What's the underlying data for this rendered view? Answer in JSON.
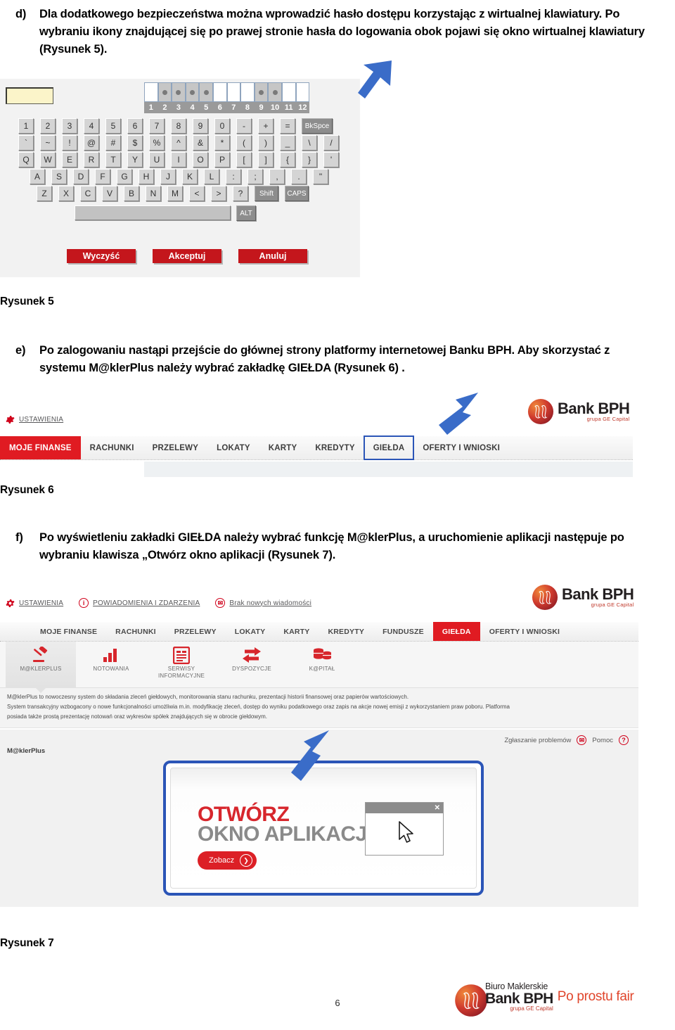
{
  "document": {
    "page_number": "6",
    "paragraphs": [
      {
        "marker": "d)",
        "text": "Dla dodatkowego bezpieczeństwa można wprowadzić hasło dostępu korzystając z wirtualnej klawiatury. Po wybraniu ikony znajdującej się po prawej stronie hasła do logowania obok pojawi się okno wirtualnej klawiatury (Rysunek 5)."
      },
      {
        "marker": "e)",
        "text": "Po zalogowaniu nastąpi przejście do głównej strony platformy internetowej Banku BPH. Aby skorzystać z systemu M@klerPlus należy wybrać zakładkę GIEŁDA (Rysunek 6) ."
      },
      {
        "marker": "f)",
        "text": "Po wyświetleniu zakładki GIEŁDA należy wybrać funkcję M@klerPlus, a uruchomienie aplikacji następuje po wybraniu klawisza „Otwórz okno aplikacji (Rysunek 7)."
      }
    ],
    "captions": {
      "fig5": "Rysunek 5",
      "fig6": "Rysunek 6",
      "fig7": "Rysunek 7"
    }
  },
  "figure5": {
    "password_field_value": "",
    "strength_meter": {
      "numbers": [
        "1",
        "2",
        "3",
        "4",
        "5",
        "6",
        "7",
        "8",
        "9",
        "10",
        "11",
        "12"
      ],
      "filled": [
        false,
        true,
        true,
        true,
        true,
        false,
        false,
        false,
        true,
        true,
        false,
        false
      ]
    },
    "keyboard_rows": [
      [
        "1",
        "2",
        "3",
        "4",
        "5",
        "6",
        "7",
        "8",
        "9",
        "0",
        "-",
        "+",
        "=",
        "BkSpce"
      ],
      [
        "`",
        "~",
        "!",
        "@",
        "#",
        "$",
        "%",
        "^",
        "&",
        "*",
        "(",
        ")",
        "_",
        "\\",
        "/"
      ],
      [
        "Q",
        "W",
        "E",
        "R",
        "T",
        "Y",
        "U",
        "I",
        "O",
        "P",
        "[",
        "]",
        "{",
        "}",
        "'"
      ],
      [
        "A",
        "S",
        "D",
        "F",
        "G",
        "H",
        "J",
        "K",
        "L",
        ":",
        ";",
        ",",
        ".",
        "\""
      ],
      [
        "Z",
        "X",
        "C",
        "V",
        "B",
        "N",
        "M",
        "<",
        ">",
        "?",
        "Shift",
        "CAPS"
      ]
    ],
    "alt_key": "ALT",
    "action_buttons": [
      "Wyczyść",
      "Akceptuj",
      "Anuluj"
    ],
    "colors": {
      "action_red": "#c4161c",
      "field_yellow": "#fbf4c9"
    }
  },
  "figure6": {
    "utility_links": [
      {
        "icon": "gear-icon",
        "label": "USTAWIENIA"
      }
    ],
    "logo": {
      "line1_light": "Bank ",
      "line1_bold": "BPH",
      "line2": "grupa GE Capital"
    },
    "nav_tabs": [
      {
        "label": "MOJE FINANSE",
        "state": "active-red"
      },
      {
        "label": "RACHUNKI",
        "state": "normal"
      },
      {
        "label": "PRZELEWY",
        "state": "normal"
      },
      {
        "label": "LOKATY",
        "state": "normal"
      },
      {
        "label": "KARTY",
        "state": "normal"
      },
      {
        "label": "KREDYTY",
        "state": "normal"
      },
      {
        "label": "GIEŁDA",
        "state": "highlighted"
      },
      {
        "label": "OFERTY I WNIOSKI",
        "state": "normal"
      }
    ],
    "colors": {
      "tab_red": "#e01b22",
      "highlight_blue": "#2b55b7"
    }
  },
  "figure7": {
    "utility_links": [
      {
        "icon": "gear-icon",
        "glyph": "",
        "label": "USTAWIENIA"
      },
      {
        "icon": "info-icon",
        "glyph": "i",
        "label": "POWIADOMIENIA I ZDARZENIA"
      },
      {
        "icon": "envelope-icon",
        "glyph": "✉",
        "label": "Brak nowych wiadomości"
      }
    ],
    "logo": {
      "line1_light": "Bank ",
      "line1_bold": "BPH",
      "line2": "grupa GE Capital"
    },
    "nav_tabs": [
      {
        "label": "MOJE FINANSE",
        "state": "normal"
      },
      {
        "label": "RACHUNKI",
        "state": "normal"
      },
      {
        "label": "PRZELEWY",
        "state": "normal"
      },
      {
        "label": "LOKATY",
        "state": "normal"
      },
      {
        "label": "KARTY",
        "state": "normal"
      },
      {
        "label": "KREDYTY",
        "state": "normal"
      },
      {
        "label": "FUNDUSZE",
        "state": "normal"
      },
      {
        "label": "GIEŁDA",
        "state": "active-red"
      },
      {
        "label": "OFERTY I WNIOSKI",
        "state": "normal"
      }
    ],
    "function_icons": [
      {
        "icon": "gavel-icon",
        "label": "M@KLERPLUS",
        "selected": true
      },
      {
        "icon": "bar-chart-icon",
        "label": "NOTOWANIA",
        "selected": false
      },
      {
        "icon": "document-icon",
        "label": "SERWISY INFORMACYJNE",
        "selected": false
      },
      {
        "icon": "exchange-arrows-icon",
        "label": "DYSPOZYCJE",
        "selected": false
      },
      {
        "icon": "coins-icon",
        "label": "K@PITAŁ",
        "selected": false
      }
    ],
    "description_lines": [
      "M@klerPlus to nowoczesny system do składania zleceń giełdowych, monitorowania stanu rachunku, prezentacji historii finansowej oraz papierów wartościowych.",
      "System transakcyjny wzbogacony o nowe funkcjonalności umożliwia m.in. modyfikację zleceń, dostęp do wyniku podatkowego oraz zapis na akcje nowej emisji z wykorzystaniem praw poboru. Platforma",
      "posiada także prostą prezentację notowań oraz wykresów spółek znajdujących się w obrocie giełdowym."
    ],
    "help_links": [
      {
        "label": "Zgłaszanie problemów",
        "icon": "envelope-icon",
        "glyph": "✉"
      },
      {
        "label": "Pomoc",
        "icon": "question-icon",
        "glyph": "?"
      }
    ],
    "section_label": "M@klerPlus",
    "promo": {
      "title_line1": "OTWÓRZ",
      "title_line2": "OKNO APLIKACJI",
      "button_label": "Zobacz",
      "button_glyph": "❯",
      "mini_window_close": "✕"
    },
    "colors": {
      "tab_red": "#e01b22",
      "promo_red": "#d7262c",
      "promo_grey": "#8a8a8a",
      "highlight_blue": "#2b55b7"
    }
  },
  "footer": {
    "logo_line1": "Biuro Maklerskie",
    "logo_line2_light": "Bank ",
    "logo_line2_bold": "BPH",
    "logo_line3": "grupa GE Capital",
    "tagline": "Po prostu fair"
  }
}
